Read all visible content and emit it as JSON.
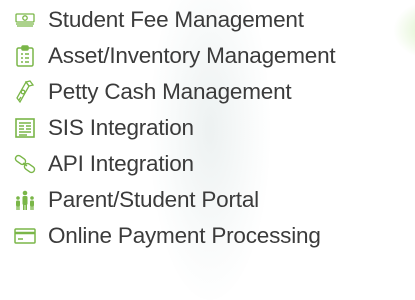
{
  "features": [
    {
      "label": "Student Fee Management",
      "icon": "money-stack-icon"
    },
    {
      "label": "Asset/Inventory Management",
      "icon": "clipboard-icon"
    },
    {
      "label": "Petty Cash Management",
      "icon": "cash-roll-icon"
    },
    {
      "label": "SIS Integration",
      "icon": "document-icon"
    },
    {
      "label": "API Integration",
      "icon": "link-icon"
    },
    {
      "label": "Parent/Student Portal",
      "icon": "people-icon"
    },
    {
      "label": "Online Payment Processing",
      "icon": "credit-card-icon"
    }
  ],
  "colors": {
    "text": "#3b3b3b",
    "icon_green": "#7ab648"
  }
}
